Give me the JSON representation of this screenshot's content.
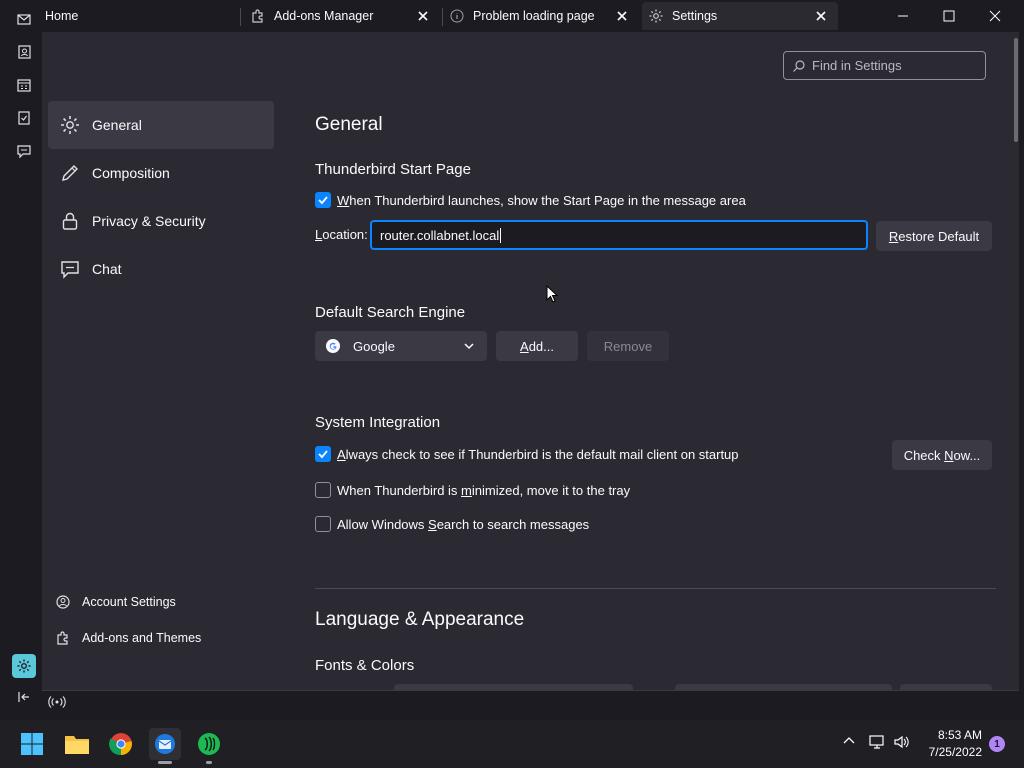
{
  "tabs": [
    {
      "label": "Home",
      "icon": "home"
    },
    {
      "label": "Add-ons Manager",
      "icon": "puzzle-icon"
    },
    {
      "label": "Problem loading page",
      "icon": "info-icon"
    },
    {
      "label": "Settings",
      "icon": "gear-icon",
      "active": true
    }
  ],
  "nav": {
    "items": [
      {
        "label": "General",
        "icon": "gear-icon",
        "selected": true
      },
      {
        "label": "Composition",
        "icon": "pencil-icon"
      },
      {
        "label": "Privacy & Security",
        "icon": "lock-icon"
      },
      {
        "label": "Chat",
        "icon": "chat-icon"
      }
    ],
    "footer": [
      {
        "label": "Account Settings",
        "icon": "account-gear-icon"
      },
      {
        "label": "Add-ons and Themes",
        "icon": "puzzle-icon"
      }
    ]
  },
  "search": {
    "placeholder": "Find in Settings"
  },
  "general": {
    "title": "General",
    "start_page": {
      "heading": "Thunderbird Start Page",
      "checkbox_prefix": "W",
      "checkbox_rest": "hen Thunderbird launches, show the Start Page in the message area",
      "checked": true,
      "location_prefix": "L",
      "location_rest": "ocation:",
      "location_value": "router.collabnet.local",
      "restore_prefix": "R",
      "restore_rest": "estore Default"
    },
    "search_engine": {
      "heading": "Default Search Engine",
      "selected": "Google",
      "add_prefix": "A",
      "add_rest": "dd...",
      "remove_label": "Remove"
    },
    "system_integration": {
      "heading": "System Integration",
      "always_prefix": "A",
      "always_rest": "lways check to see if Thunderbird is the default mail client on startup",
      "always_checked": true,
      "check_now_a": "Check ",
      "check_now_u": "N",
      "check_now_b": "ow...",
      "minimized_a": "When Thunderbird is ",
      "minimized_u": "m",
      "minimized_b": "inimized, move it to the tray",
      "minimized_checked": false,
      "winsearch_a": "Allow Windows ",
      "winsearch_u": "S",
      "winsearch_b": "earch to search messages",
      "winsearch_checked": false
    },
    "language_title": "Language & Appearance",
    "fonts_heading": "Fonts & Colors"
  },
  "taskbar": {
    "time": "8:53 AM",
    "date": "7/25/2022",
    "notifications": "1"
  },
  "colors": {
    "accent": "#0a84ff",
    "bg": "#1c1b22",
    "panel": "#2b2a33"
  }
}
